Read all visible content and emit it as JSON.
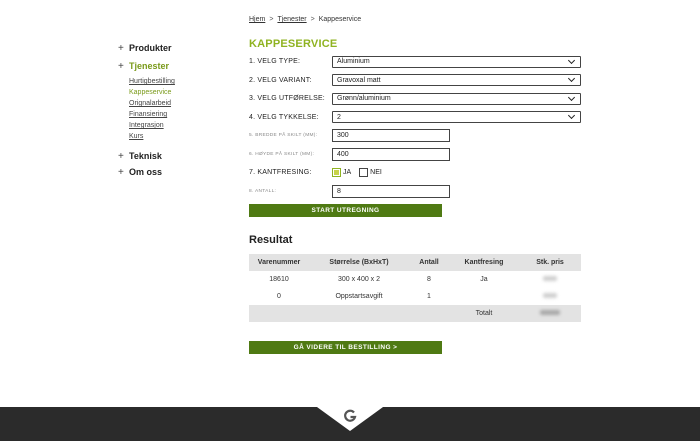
{
  "breadcrumb": {
    "home": "Hjem",
    "services": "Tjenester",
    "current": "Kappeservice",
    "sep": ">"
  },
  "sidebar": {
    "plus": "+",
    "products": "Produkter",
    "services": "Tjenester",
    "services_items": [
      "Hurtigbestilling",
      "Kappeservice",
      "Orignalarbeid",
      "Finansiering",
      "Integrasjon",
      "Kurs"
    ],
    "technical": "Teknisk",
    "about": "Om oss"
  },
  "form": {
    "title": "KAPPESERVICE",
    "type_label": "1. VELG TYPE:",
    "type_value": "Aluminium",
    "variant_label": "2. VELG VARIANT:",
    "variant_value": "Gravoxal matt",
    "finish_label": "3. VELG UTFØRELSE:",
    "finish_value": "Grønn/aluminium",
    "thickness_label": "4. VELG TYKKELSE:",
    "thickness_value": "2",
    "width_label": "5. BREDDE PÅ SKILT (MM):",
    "width_value": "300",
    "height_label": "6. HØYDE PÅ SKILT (MM):",
    "height_value": "400",
    "edge_label": "7. KANTFRESING:",
    "edge_yes": "JA",
    "edge_no": "NEI",
    "qty_label": "8. ANTALL:",
    "qty_value": "8",
    "start_button": "START UTREGNING"
  },
  "result": {
    "title": "Resultat",
    "headers": [
      "Varenummer",
      "Størrelse (BxHxT)",
      "Antall",
      "Kantfresing",
      "Stk. pris"
    ],
    "rows": [
      [
        "18610",
        "300 x 400 x 2",
        "8",
        "Ja"
      ],
      [
        "0",
        "Oppstartsavgift",
        "1",
        ""
      ]
    ],
    "total_label": "Totalt",
    "next_button": "GÅ VIDERE TIL BESTILLING >"
  },
  "colors": {
    "accent": "#8fb321",
    "button": "#4f7a13",
    "footer": "#2b2b2b"
  },
  "icons": {
    "footer_logo": "g-logo-icon"
  }
}
